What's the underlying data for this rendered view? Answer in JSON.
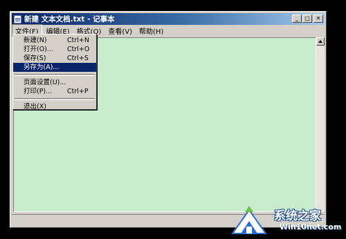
{
  "window": {
    "title": "新建 文本文档.txt - 记事本",
    "minimize_glyph": "_",
    "maximize_glyph": "□",
    "close_glyph": "✕"
  },
  "menubar": {
    "items": [
      {
        "label": "文件(F)"
      },
      {
        "label": "编辑(E)"
      },
      {
        "label": "格式(O)"
      },
      {
        "label": "查看(V)"
      },
      {
        "label": "帮助(H)"
      }
    ]
  },
  "file_menu": {
    "items": [
      {
        "label": "新建(N)",
        "shortcut": "Ctrl+N"
      },
      {
        "label": "打开(O)...",
        "shortcut": "Ctrl+O"
      },
      {
        "label": "保存(S)",
        "shortcut": "Ctrl+S"
      },
      {
        "label": "另存为(A)...",
        "shortcut": "",
        "selected": true
      },
      {
        "label": "页面设置(U)...",
        "shortcut": ""
      },
      {
        "label": "打印(P)...",
        "shortcut": "Ctrl+P"
      },
      {
        "label": "退出(X)",
        "shortcut": ""
      }
    ]
  },
  "editor": {
    "background": "#c8ebcb"
  },
  "watermark": {
    "title": "系统之家",
    "url": "Win10net.com"
  },
  "colors": {
    "titlebar_start": "#0a246a",
    "titlebar_end": "#a6caf0",
    "menu_highlight": "#0a246a"
  },
  "icons": {
    "app": "notepad-icon",
    "scroll_up": "arrow-up-icon",
    "logo": "house-logo-icon"
  }
}
